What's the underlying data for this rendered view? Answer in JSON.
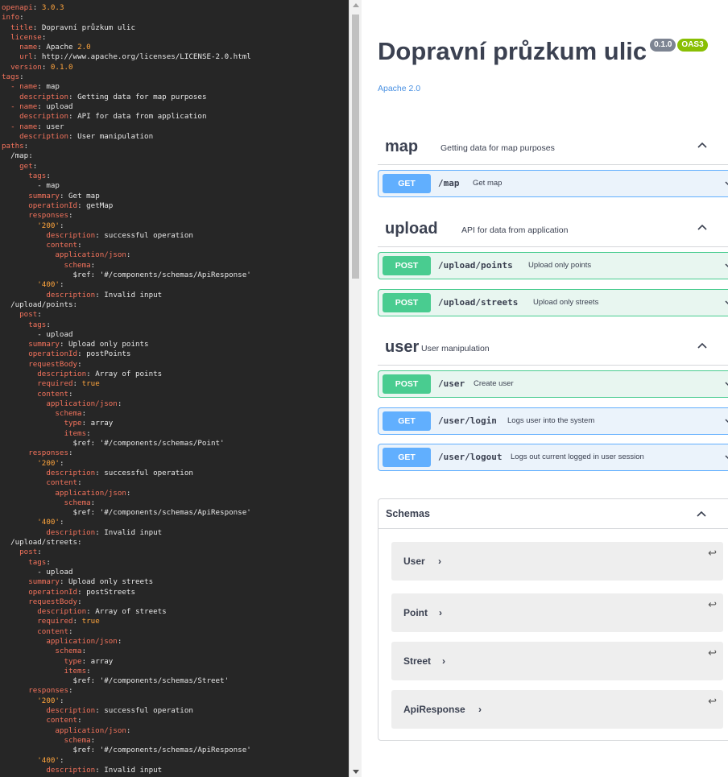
{
  "editor": {
    "lines": [
      [
        [
          "k",
          "openapi"
        ],
        [
          "v",
          ": "
        ],
        [
          "n",
          "3.0.3"
        ]
      ],
      [
        [
          "k",
          "info"
        ],
        [
          "v",
          ":"
        ]
      ],
      [
        [
          "i",
          "  "
        ],
        [
          "k",
          "title"
        ],
        [
          "v",
          ": Dopravní průzkum ulic"
        ]
      ],
      [
        [
          "i",
          "  "
        ],
        [
          "k",
          "license"
        ],
        [
          "v",
          ":"
        ]
      ],
      [
        [
          "i",
          "    "
        ],
        [
          "k",
          "name"
        ],
        [
          "v",
          ": Apache "
        ],
        [
          "n",
          "2.0"
        ]
      ],
      [
        [
          "i",
          "    "
        ],
        [
          "k",
          "url"
        ],
        [
          "v",
          ": http://www.apache.org/licenses/LICENSE-2.0.html"
        ]
      ],
      [
        [
          "i",
          "  "
        ],
        [
          "k",
          "version"
        ],
        [
          "v",
          ": "
        ],
        [
          "n",
          "0.1.0"
        ]
      ],
      [
        [
          "k",
          "tags"
        ],
        [
          "v",
          ":"
        ]
      ],
      [
        [
          "i",
          "  "
        ],
        [
          "k",
          "- name"
        ],
        [
          "v",
          ": map"
        ]
      ],
      [
        [
          "i",
          "    "
        ],
        [
          "k",
          "description"
        ],
        [
          "v",
          ": Getting data for map purposes"
        ]
      ],
      [
        [
          "i",
          "  "
        ],
        [
          "k",
          "- name"
        ],
        [
          "v",
          ": upload"
        ]
      ],
      [
        [
          "i",
          "    "
        ],
        [
          "k",
          "description"
        ],
        [
          "v",
          ": API for data from application"
        ]
      ],
      [
        [
          "i",
          "  "
        ],
        [
          "k",
          "- name"
        ],
        [
          "v",
          ": user"
        ]
      ],
      [
        [
          "i",
          "    "
        ],
        [
          "k",
          "description"
        ],
        [
          "v",
          ": User manipulation"
        ]
      ],
      [
        [
          "k",
          "paths"
        ],
        [
          "v",
          ":"
        ]
      ],
      [
        [
          "i",
          "  "
        ],
        [
          "v",
          "/map:"
        ]
      ],
      [
        [
          "i",
          "    "
        ],
        [
          "k",
          "get"
        ],
        [
          "v",
          ":"
        ]
      ],
      [
        [
          "i",
          "      "
        ],
        [
          "k",
          "tags"
        ],
        [
          "v",
          ":"
        ]
      ],
      [
        [
          "i",
          "        "
        ],
        [
          "v",
          "- map"
        ]
      ],
      [
        [
          "i",
          "      "
        ],
        [
          "k",
          "summary"
        ],
        [
          "v",
          ": Get map"
        ]
      ],
      [
        [
          "i",
          "      "
        ],
        [
          "k",
          "operationId"
        ],
        [
          "v",
          ": getMap"
        ]
      ],
      [
        [
          "i",
          "      "
        ],
        [
          "k",
          "responses"
        ],
        [
          "v",
          ":"
        ]
      ],
      [
        [
          "i",
          "        "
        ],
        [
          "n",
          "'200'"
        ],
        [
          "v",
          ":"
        ]
      ],
      [
        [
          "i",
          "          "
        ],
        [
          "k",
          "description"
        ],
        [
          "v",
          ": successful operation"
        ]
      ],
      [
        [
          "i",
          "          "
        ],
        [
          "k",
          "content"
        ],
        [
          "v",
          ":"
        ]
      ],
      [
        [
          "i",
          "            "
        ],
        [
          "k",
          "application/json"
        ],
        [
          "v",
          ":"
        ]
      ],
      [
        [
          "i",
          "              "
        ],
        [
          "k",
          "schema"
        ],
        [
          "v",
          ":"
        ]
      ],
      [
        [
          "i",
          "                "
        ],
        [
          "v",
          "$ref: '#/components/schemas/ApiResponse'"
        ]
      ],
      [
        [
          "i",
          "        "
        ],
        [
          "n",
          "'400'"
        ],
        [
          "v",
          ":"
        ]
      ],
      [
        [
          "i",
          "          "
        ],
        [
          "k",
          "description"
        ],
        [
          "v",
          ": Invalid input"
        ]
      ],
      [
        [
          "i",
          "  "
        ],
        [
          "v",
          "/upload/points:"
        ]
      ],
      [
        [
          "i",
          "    "
        ],
        [
          "k",
          "post"
        ],
        [
          "v",
          ":"
        ]
      ],
      [
        [
          "i",
          "      "
        ],
        [
          "k",
          "tags"
        ],
        [
          "v",
          ":"
        ]
      ],
      [
        [
          "i",
          "        "
        ],
        [
          "v",
          "- upload"
        ]
      ],
      [
        [
          "i",
          "      "
        ],
        [
          "k",
          "summary"
        ],
        [
          "v",
          ": Upload only points"
        ]
      ],
      [
        [
          "i",
          "      "
        ],
        [
          "k",
          "operationId"
        ],
        [
          "v",
          ": postPoints"
        ]
      ],
      [
        [
          "i",
          "      "
        ],
        [
          "k",
          "requestBody"
        ],
        [
          "v",
          ":"
        ]
      ],
      [
        [
          "i",
          "        "
        ],
        [
          "k",
          "description"
        ],
        [
          "v",
          ": Array of points"
        ]
      ],
      [
        [
          "i",
          "        "
        ],
        [
          "k",
          "required"
        ],
        [
          "v",
          ": "
        ],
        [
          "n",
          "true"
        ]
      ],
      [
        [
          "i",
          "        "
        ],
        [
          "k",
          "content"
        ],
        [
          "v",
          ":"
        ]
      ],
      [
        [
          "i",
          "          "
        ],
        [
          "k",
          "application/json"
        ],
        [
          "v",
          ":"
        ]
      ],
      [
        [
          "i",
          "            "
        ],
        [
          "k",
          "schema"
        ],
        [
          "v",
          ":"
        ]
      ],
      [
        [
          "i",
          "              "
        ],
        [
          "k",
          "type"
        ],
        [
          "v",
          ": array"
        ]
      ],
      [
        [
          "i",
          "              "
        ],
        [
          "k",
          "items"
        ],
        [
          "v",
          ":"
        ]
      ],
      [
        [
          "i",
          "                "
        ],
        [
          "v",
          "$ref: '#/components/schemas/Point'"
        ]
      ],
      [
        [
          "i",
          "      "
        ],
        [
          "k",
          "responses"
        ],
        [
          "v",
          ":"
        ]
      ],
      [
        [
          "i",
          "        "
        ],
        [
          "n",
          "'200'"
        ],
        [
          "v",
          ":"
        ]
      ],
      [
        [
          "i",
          "          "
        ],
        [
          "k",
          "description"
        ],
        [
          "v",
          ": successful operation"
        ]
      ],
      [
        [
          "i",
          "          "
        ],
        [
          "k",
          "content"
        ],
        [
          "v",
          ":"
        ]
      ],
      [
        [
          "i",
          "            "
        ],
        [
          "k",
          "application/json"
        ],
        [
          "v",
          ":"
        ]
      ],
      [
        [
          "i",
          "              "
        ],
        [
          "k",
          "schema"
        ],
        [
          "v",
          ":"
        ]
      ],
      [
        [
          "i",
          "                "
        ],
        [
          "v",
          "$ref: '#/components/schemas/ApiResponse'"
        ]
      ],
      [
        [
          "i",
          "        "
        ],
        [
          "n",
          "'400'"
        ],
        [
          "v",
          ":"
        ]
      ],
      [
        [
          "i",
          "          "
        ],
        [
          "k",
          "description"
        ],
        [
          "v",
          ": Invalid input"
        ]
      ],
      [
        [
          "i",
          "  "
        ],
        [
          "v",
          "/upload/streets:"
        ]
      ],
      [
        [
          "i",
          "    "
        ],
        [
          "k",
          "post"
        ],
        [
          "v",
          ":"
        ]
      ],
      [
        [
          "i",
          "      "
        ],
        [
          "k",
          "tags"
        ],
        [
          "v",
          ":"
        ]
      ],
      [
        [
          "i",
          "        "
        ],
        [
          "v",
          "- upload"
        ]
      ],
      [
        [
          "i",
          "      "
        ],
        [
          "k",
          "summary"
        ],
        [
          "v",
          ": Upload only streets"
        ]
      ],
      [
        [
          "i",
          "      "
        ],
        [
          "k",
          "operationId"
        ],
        [
          "v",
          ": postStreets"
        ]
      ],
      [
        [
          "i",
          "      "
        ],
        [
          "k",
          "requestBody"
        ],
        [
          "v",
          ":"
        ]
      ],
      [
        [
          "i",
          "        "
        ],
        [
          "k",
          "description"
        ],
        [
          "v",
          ": Array of streets"
        ]
      ],
      [
        [
          "i",
          "        "
        ],
        [
          "k",
          "required"
        ],
        [
          "v",
          ": "
        ],
        [
          "n",
          "true"
        ]
      ],
      [
        [
          "i",
          "        "
        ],
        [
          "k",
          "content"
        ],
        [
          "v",
          ":"
        ]
      ],
      [
        [
          "i",
          "          "
        ],
        [
          "k",
          "application/json"
        ],
        [
          "v",
          ":"
        ]
      ],
      [
        [
          "i",
          "            "
        ],
        [
          "k",
          "schema"
        ],
        [
          "v",
          ":"
        ]
      ],
      [
        [
          "i",
          "              "
        ],
        [
          "k",
          "type"
        ],
        [
          "v",
          ": array"
        ]
      ],
      [
        [
          "i",
          "              "
        ],
        [
          "k",
          "items"
        ],
        [
          "v",
          ":"
        ]
      ],
      [
        [
          "i",
          "                "
        ],
        [
          "v",
          "$ref: '#/components/schemas/Street'"
        ]
      ],
      [
        [
          "i",
          "      "
        ],
        [
          "k",
          "responses"
        ],
        [
          "v",
          ":"
        ]
      ],
      [
        [
          "i",
          "        "
        ],
        [
          "n",
          "'200'"
        ],
        [
          "v",
          ":"
        ]
      ],
      [
        [
          "i",
          "          "
        ],
        [
          "k",
          "description"
        ],
        [
          "v",
          ": successful operation"
        ]
      ],
      [
        [
          "i",
          "          "
        ],
        [
          "k",
          "content"
        ],
        [
          "v",
          ":"
        ]
      ],
      [
        [
          "i",
          "            "
        ],
        [
          "k",
          "application/json"
        ],
        [
          "v",
          ":"
        ]
      ],
      [
        [
          "i",
          "              "
        ],
        [
          "k",
          "schema"
        ],
        [
          "v",
          ":"
        ]
      ],
      [
        [
          "i",
          "                "
        ],
        [
          "v",
          "$ref: '#/components/schemas/ApiResponse'"
        ]
      ],
      [
        [
          "i",
          "        "
        ],
        [
          "n",
          "'400'"
        ],
        [
          "v",
          ":"
        ]
      ],
      [
        [
          "i",
          "          "
        ],
        [
          "k",
          "description"
        ],
        [
          "v",
          ": Invalid input"
        ]
      ]
    ]
  },
  "swagger": {
    "title": "Dopravní průzkum ulic",
    "version_badge": "0.1.0",
    "oas_badge": "OAS3",
    "license_link": "Apache 2.0",
    "tags": [
      {
        "name": "map",
        "description": "Getting data for map purposes",
        "operations": [
          {
            "method": "GET",
            "path": "/map",
            "summary": "Get map"
          }
        ]
      },
      {
        "name": "upload",
        "description": "API for data from application",
        "operations": [
          {
            "method": "POST",
            "path": "/upload/points",
            "summary": "Upload only points"
          },
          {
            "method": "POST",
            "path": "/upload/streets",
            "summary": "Upload only streets"
          }
        ]
      },
      {
        "name": "user",
        "description": "User manipulation",
        "operations": [
          {
            "method": "POST",
            "path": "/user",
            "summary": "Create user"
          },
          {
            "method": "GET",
            "path": "/user/login",
            "summary": "Logs user into the system"
          },
          {
            "method": "GET",
            "path": "/user/logout",
            "summary": "Logs out current logged in user session"
          }
        ]
      }
    ],
    "schemas_label": "Schemas",
    "schemas": [
      "User",
      "Point",
      "Street",
      "ApiResponse"
    ],
    "model_arrow": "›",
    "return_icon": "↩"
  },
  "colors": {
    "get": "#61affe",
    "post": "#49cc90",
    "oas": "#89bf04",
    "link": "#4990e2",
    "yaml_key": "#f4735c",
    "yaml_number": "#ffa53d"
  }
}
